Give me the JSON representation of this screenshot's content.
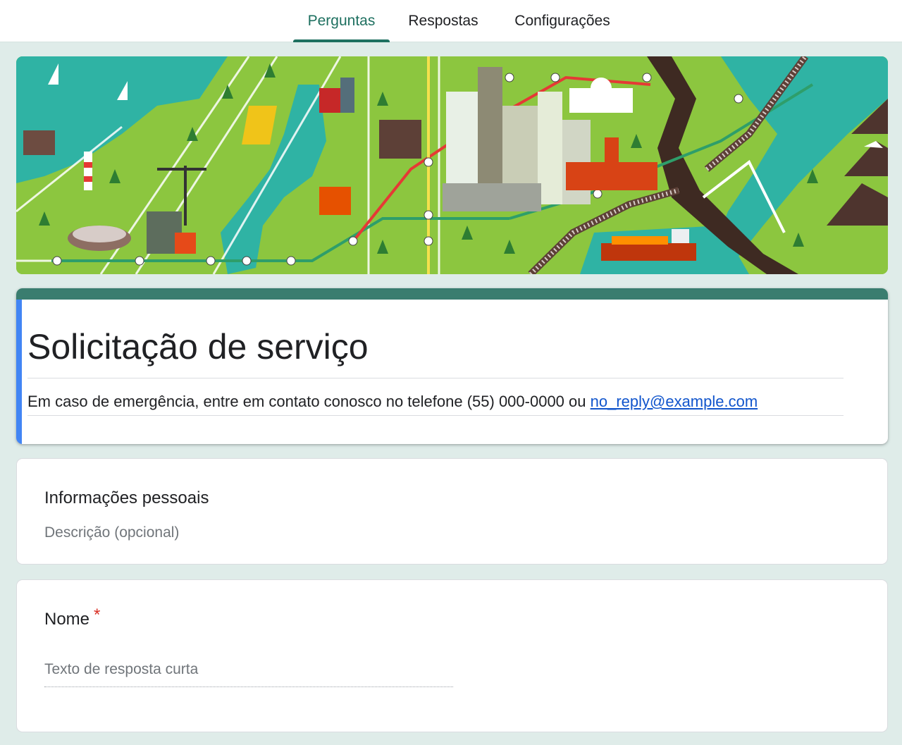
{
  "tabs": [
    {
      "label": "Perguntas",
      "active": true
    },
    {
      "label": "Respostas",
      "active": false
    },
    {
      "label": "Configurações",
      "active": false
    }
  ],
  "theme": {
    "accent": "#1e7060",
    "header_strip": "#3a7d6f",
    "focus_strip": "#4285f4",
    "background": "#dfece9",
    "required": "#d93025",
    "link": "#1155cc"
  },
  "form": {
    "title": "Solicitação de serviço",
    "description_text": "Em caso de emergência, entre em contato conosco no telefone (55) 000-0000 ou ",
    "description_link": "no_reply@example.com"
  },
  "section": {
    "title": "Informações pessoais",
    "description_placeholder": "Descrição (opcional)"
  },
  "question": {
    "title": "Nome",
    "required_mark": "*",
    "answer_placeholder": "Texto de resposta curta"
  },
  "icons": [
    "city-map-header-illustration"
  ]
}
